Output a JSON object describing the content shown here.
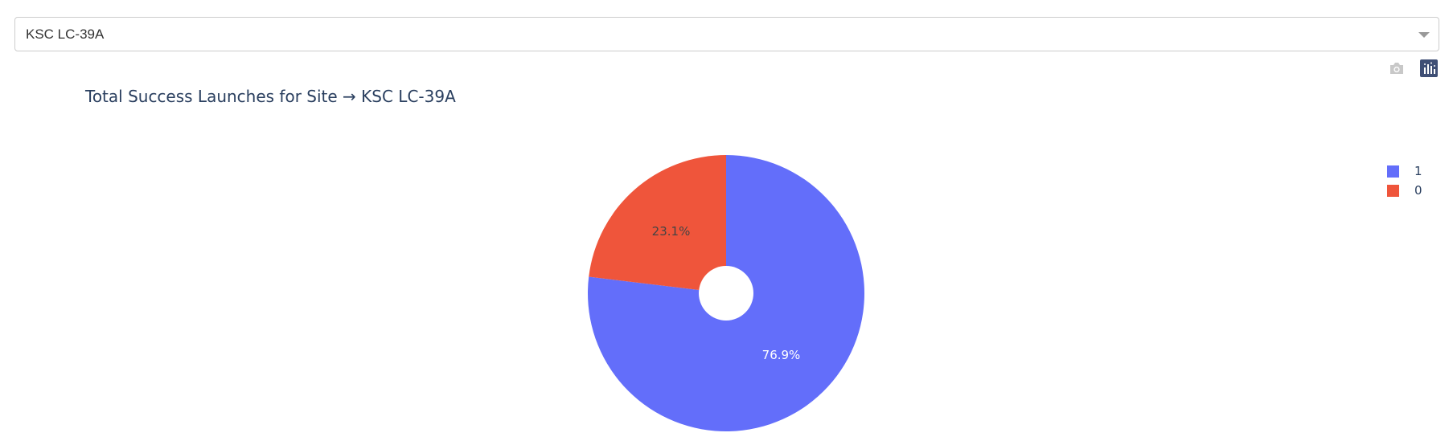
{
  "dropdown": {
    "selected": "KSC LC-39A"
  },
  "modebar": {
    "icons": [
      "camera-icon",
      "plotly-logo-icon"
    ]
  },
  "colors": {
    "slice_1": "#636efa",
    "slice_0": "#ef553b",
    "title": "#2a3f5f",
    "label_dark": "#444444",
    "label_light": "#ffffff"
  },
  "chart_data": {
    "type": "pie",
    "title": "Total Success Launches for Site → KSC LC-39A",
    "hole": true,
    "slices": [
      {
        "label": "1",
        "value": 76.9,
        "text": "76.9%",
        "color": "#636efa"
      },
      {
        "label": "0",
        "value": 23.1,
        "text": "23.1%",
        "color": "#ef553b"
      }
    ],
    "legend": [
      "1",
      "0"
    ],
    "legend_position": "top-right"
  }
}
